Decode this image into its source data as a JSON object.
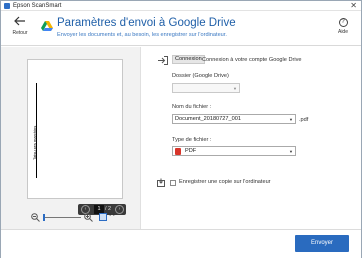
{
  "window": {
    "title": "Epson ScanSmart",
    "close_glyph": "✕"
  },
  "header": {
    "back_label": "Retour",
    "title": "Paramètres d'envoi à Google Drive",
    "subtitle": "Envoyer les documents et, au besoin, les enregistrer sur l'ordinateur.",
    "help_label": "Aide",
    "help_glyph": "?"
  },
  "preview": {
    "vertical_text": "Tatsu xes marchins",
    "pager": {
      "prev": "‹",
      "current": "1",
      "total": "/ 2",
      "next": "›"
    }
  },
  "connection": {
    "button_label": "Connexion",
    "status_text": "Connexion à votre compte Google Drive"
  },
  "folder": {
    "label": "Dossier (Google Drive)",
    "value": ""
  },
  "filename": {
    "label": "Nom du fichier :",
    "value": "Document_20180727_001",
    "extension": ".pdf"
  },
  "filetype": {
    "label": "Type de fichier :",
    "value": "PDF"
  },
  "save_copy": {
    "label": "Enregistrer une copie sur l'ordinateur",
    "checked": false
  },
  "footer": {
    "send_label": "Envoyer"
  },
  "colors": {
    "accent": "#2a6bbf",
    "title_blue": "#1f5fa8",
    "pdf_red": "#d8352a"
  },
  "icons": [
    "app-icon",
    "back-arrow-icon",
    "google-drive-icon",
    "help-icon",
    "login-icon",
    "save-to-computer-icon",
    "zoom-out-icon",
    "zoom-in-icon",
    "fit-page-icon",
    "more-icon",
    "pdf-icon"
  ]
}
